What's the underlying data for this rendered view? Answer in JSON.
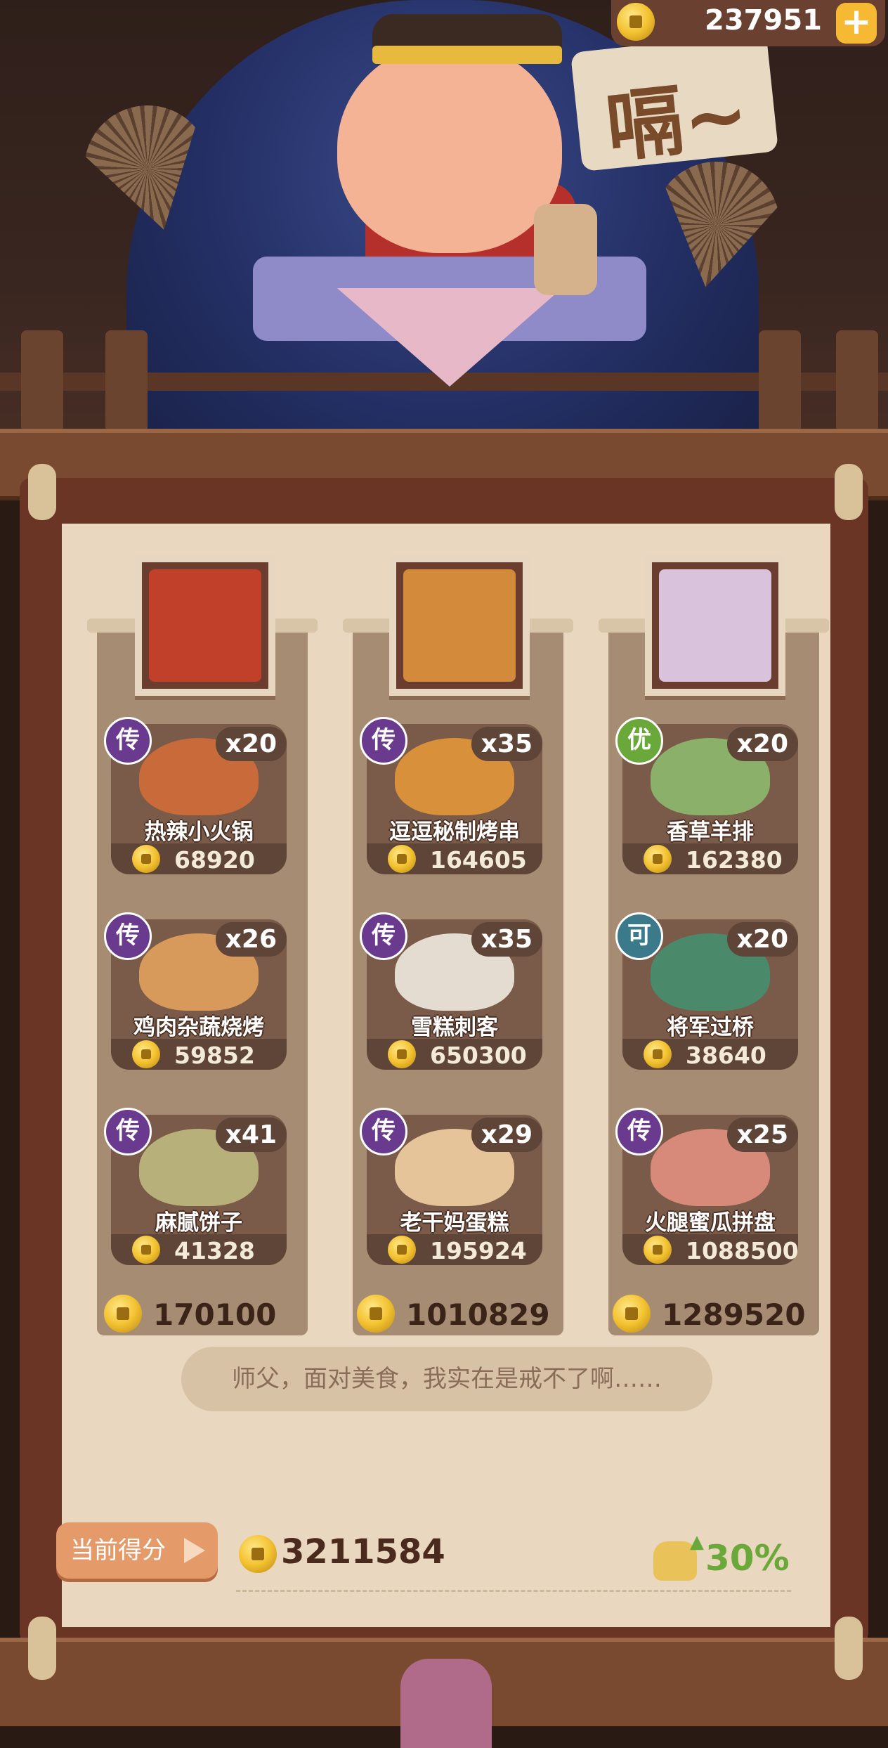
{
  "header": {
    "coin_balance": "237951",
    "speech_text": "嗝~",
    "plus_label": "+"
  },
  "columns": [
    {
      "portrait": "character-1",
      "portrait_color": "#c0402a",
      "dishes": [
        {
          "badge": "传",
          "badge_color": "#6a3a8e",
          "qty": "x20",
          "name": "热辣小火锅",
          "price": "68920",
          "img_color": "#c86a3a"
        },
        {
          "badge": "传",
          "badge_color": "#6a3a8e",
          "qty": "x26",
          "name": "鸡肉杂蔬烧烤",
          "price": "59852",
          "img_color": "#d89a5a"
        },
        {
          "badge": "传",
          "badge_color": "#6a3a8e",
          "qty": "x41",
          "name": "麻腻饼子",
          "price": "41328",
          "img_color": "#b8b07a"
        }
      ],
      "total": "170100"
    },
    {
      "portrait": "character-2",
      "portrait_color": "#d38a3a",
      "dishes": [
        {
          "badge": "传",
          "badge_color": "#6a3a8e",
          "qty": "x35",
          "name": "逗逗秘制烤串",
          "price": "164605",
          "img_color": "#d8903a"
        },
        {
          "badge": "传",
          "badge_color": "#6a3a8e",
          "qty": "x35",
          "name": "雪糕刺客",
          "price": "650300",
          "img_color": "#e4dcd0"
        },
        {
          "badge": "传",
          "badge_color": "#6a3a8e",
          "qty": "x29",
          "name": "老干妈蛋糕",
          "price": "195924",
          "img_color": "#e6c49a"
        }
      ],
      "total": "1010829"
    },
    {
      "portrait": "character-3",
      "portrait_color": "#d8c2dc",
      "dishes": [
        {
          "badge": "优",
          "badge_color": "#6aa83a",
          "qty": "x20",
          "name": "香草羊排",
          "price": "162380",
          "img_color": "#8ab06a"
        },
        {
          "badge": "可",
          "badge_color": "#3a7a8a",
          "qty": "x20",
          "name": "将军过桥",
          "price": "38640",
          "img_color": "#4a8a6a"
        },
        {
          "badge": "传",
          "badge_color": "#6a3a8e",
          "qty": "x25",
          "name": "火腿蜜瓜拼盘",
          "price": "1088500",
          "img_color": "#d88a7a"
        }
      ],
      "total": "1289520"
    }
  ],
  "quote": "师父，面对美食，我实在是戒不了啊……",
  "footer": {
    "score_label": "当前得分",
    "score_value": "3211584",
    "percent": "30%"
  }
}
